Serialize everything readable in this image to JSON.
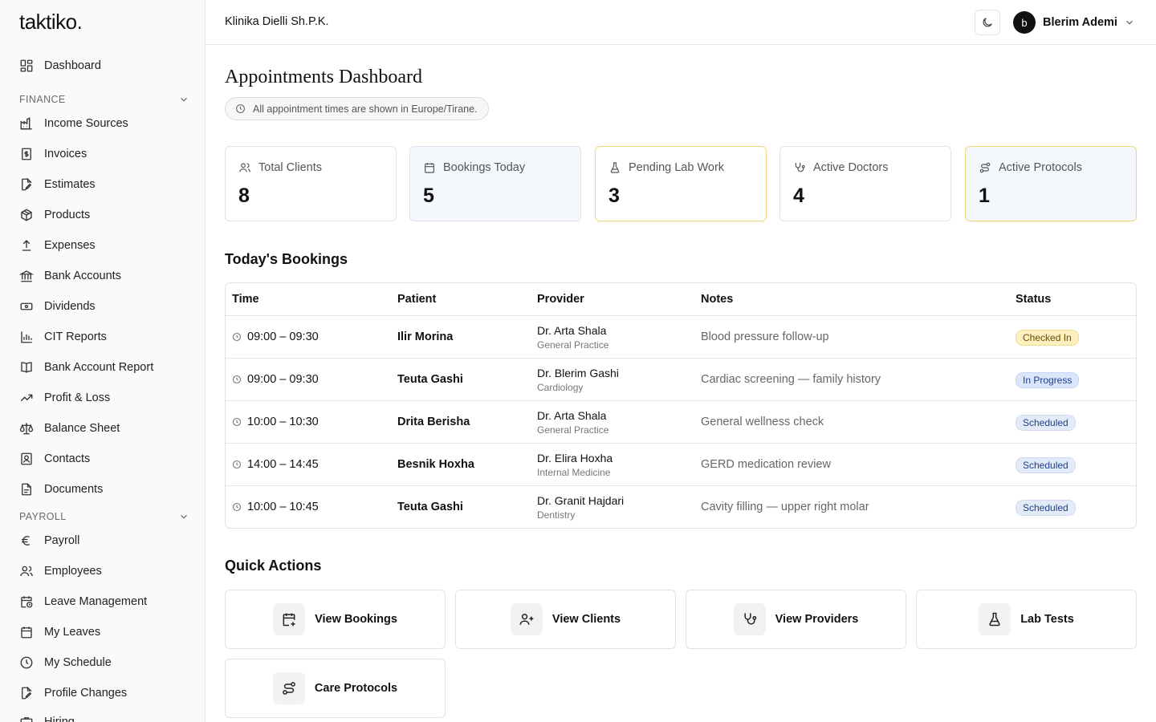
{
  "app": {
    "logo": "taktiko."
  },
  "header": {
    "company": "Klinika Dielli Sh.P.K.",
    "user_initial": "b",
    "user_name": "Blerim Ademi"
  },
  "sidebar": {
    "dashboard": "Dashboard",
    "finance_label": "FINANCE",
    "finance_items": [
      "Income Sources",
      "Invoices",
      "Estimates",
      "Products",
      "Expenses",
      "Bank Accounts",
      "Dividends",
      "CIT Reports",
      "Bank Account Report",
      "Profit & Loss",
      "Balance Sheet",
      "Contacts",
      "Documents"
    ],
    "payroll_label": "PAYROLL",
    "payroll_items": [
      "Payroll",
      "Employees",
      "Leave Management",
      "My Leaves",
      "My Schedule",
      "Profile Changes",
      "Hiring"
    ]
  },
  "main": {
    "title": "Appointments Dashboard",
    "timezone_note": "All appointment times are shown in Europe/Tirane.",
    "stats": [
      {
        "label": "Total Clients",
        "value": "8",
        "icon": "users-icon"
      },
      {
        "label": "Bookings Today",
        "value": "5",
        "icon": "calendar-icon"
      },
      {
        "label": "Pending Lab Work",
        "value": "3",
        "icon": "flask-icon"
      },
      {
        "label": "Active Doctors",
        "value": "4",
        "icon": "stethoscope-icon"
      },
      {
        "label": "Active Protocols",
        "value": "1",
        "icon": "route-icon"
      }
    ],
    "bookings_title": "Today's Bookings",
    "table_headers": [
      "Time",
      "Patient",
      "Provider",
      "Notes",
      "Status"
    ],
    "bookings": [
      {
        "time": "09:00 – 09:30",
        "patient": "Ilir Morina",
        "provider": "Dr. Arta Shala",
        "specialty": "General Practice",
        "notes": "Blood pressure follow-up",
        "status": "Checked In"
      },
      {
        "time": "09:00 – 09:30",
        "patient": "Teuta Gashi",
        "provider": "Dr. Blerim Gashi",
        "specialty": "Cardiology",
        "notes": "Cardiac screening — family history",
        "status": "In Progress"
      },
      {
        "time": "10:00 – 10:30",
        "patient": "Drita Berisha",
        "provider": "Dr. Arta Shala",
        "specialty": "General Practice",
        "notes": "General wellness check",
        "status": "Scheduled"
      },
      {
        "time": "14:00 – 14:45",
        "patient": "Besnik Hoxha",
        "provider": "Dr. Elira Hoxha",
        "specialty": "Internal Medicine",
        "notes": "GERD medication review",
        "status": "Scheduled"
      },
      {
        "time": "10:00 – 10:45",
        "patient": "Teuta Gashi",
        "provider": "Dr. Granit Hajdari",
        "specialty": "Dentistry",
        "notes": "Cavity filling — upper right molar",
        "status": "Scheduled"
      }
    ],
    "quick_actions_title": "Quick Actions",
    "quick_actions": [
      "View Bookings",
      "View Clients",
      "View Providers",
      "Lab Tests",
      "Care Protocols"
    ]
  }
}
